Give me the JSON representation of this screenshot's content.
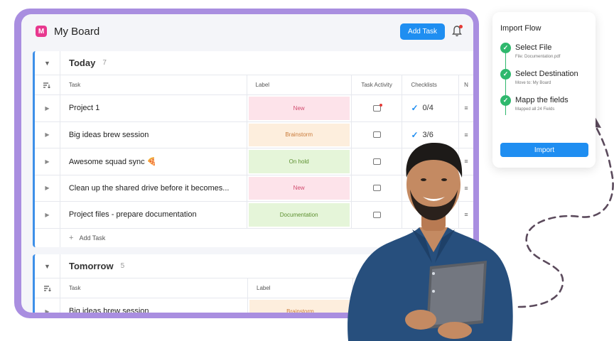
{
  "board": {
    "logo_letter": "M",
    "title": "My Board",
    "add_task_label": "Add Task"
  },
  "groups": [
    {
      "title": "Today",
      "count": "7",
      "columns": [
        "Task",
        "Label",
        "Task Activity",
        "Checklists",
        "N"
      ],
      "rows": [
        {
          "task": "Project 1",
          "label": "New",
          "label_bg": "#fde3ea",
          "label_color": "#d14b6e",
          "checklist": "0/4",
          "has_check": true,
          "activity_dot": true
        },
        {
          "task": "Big ideas brew session",
          "label": "Brainstorm",
          "label_bg": "#fdeedd",
          "label_color": "#c97b3b",
          "checklist": "3/6",
          "has_check": true,
          "activity_dot": false
        },
        {
          "task": "Awesome squad sync 🍕",
          "label": "On hold",
          "label_bg": "#e5f5d9",
          "label_color": "#5c8f2f",
          "checklist": "",
          "has_check": false,
          "activity_dot": false
        },
        {
          "task": "Clean up the shared drive before it becomes...",
          "label": "New",
          "label_bg": "#fde3ea",
          "label_color": "#d14b6e",
          "checklist": "",
          "has_check": false,
          "activity_dot": false
        },
        {
          "task": "Project files - prepare documentation",
          "label": "Documentation",
          "label_bg": "#e5f5d9",
          "label_color": "#5c8f2f",
          "checklist": "",
          "has_check": false,
          "activity_dot": false
        }
      ],
      "add_label": "Add Task"
    },
    {
      "title": "Tomorrow",
      "count": "5",
      "columns": [
        "Task",
        "Label"
      ],
      "rows": [
        {
          "task": "Big ideas brew session",
          "label": "Brainstorm",
          "label_bg": "#fdeedd",
          "label_color": "#c97b3b"
        }
      ]
    }
  ],
  "import_flow": {
    "title": "Import Flow",
    "steps": [
      {
        "title": "Select File",
        "sub": "File: Documentation.pdf"
      },
      {
        "title": "Select Destination",
        "sub": "Move to: My Board"
      },
      {
        "title": "Mapp the fields",
        "sub": "Mapped all 24 Fields"
      }
    ],
    "button_label": "Import"
  },
  "colors": {
    "accent": "#1f8ef1",
    "frame": "#a98ee0",
    "success": "#2fb86d"
  }
}
